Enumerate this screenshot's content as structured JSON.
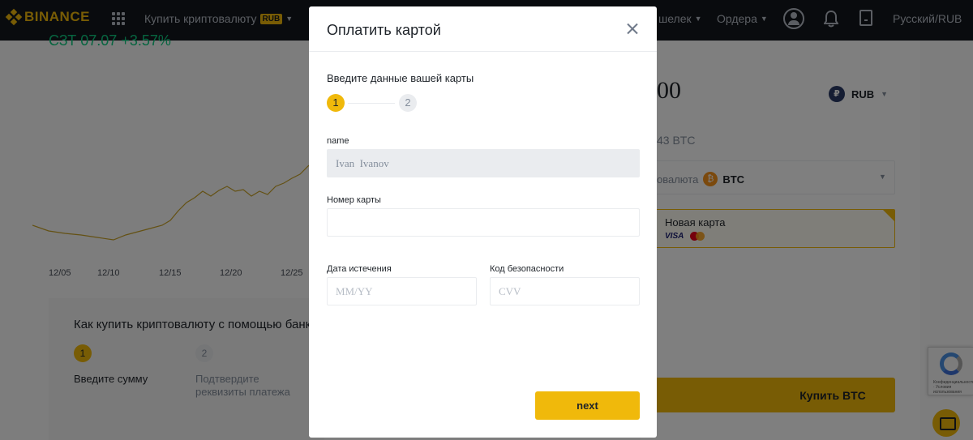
{
  "header": {
    "logo_text": "BINANCE",
    "nav_buy_label": "Купить криптовалюту",
    "nav_buy_badge": "RUB",
    "nav_wallet_label": "шелек",
    "nav_orders_label": "Ордера",
    "nav_lang_label": "Русский/RUB"
  },
  "background": {
    "price_partial": "СЗТ 07.07  +3.57%",
    "chart_dates": [
      "12/05",
      "12/10",
      "12/15",
      "12/20",
      "12/25"
    ],
    "how_to": {
      "title": "Как купить криптовалюту с помощью банк",
      "step1_number": "1",
      "step1_label": "Введите сумму",
      "step2_number": "2",
      "step2_label": "Подтвердите реквизиты платежа"
    },
    "buy_panel": {
      "amount_partial": "00",
      "fiat_symbol": "₽",
      "fiat_code": "RUB",
      "btc_estimate_partial": "43 BTC",
      "currency_label_partial": "овалюта",
      "crypto_code": "BTC",
      "crypto_symbol": "₿",
      "card_label": "Новая карта",
      "card_brand_visa": "VISA",
      "buy_button_label": "Купить BTC"
    },
    "recaptcha_text": "Конфиденциальность · Условия использования"
  },
  "modal": {
    "title": "Оплатить картой",
    "subtitle": "Введите данные вашей карты",
    "steps": [
      "1",
      "2"
    ],
    "current_step": 1,
    "name_label": "name",
    "name_value": "Ivan  Ivanov",
    "card_number_label": "Номер карты",
    "card_number_value": "",
    "expiry_label": "Дата истечения",
    "expiry_placeholder": "MM/YY",
    "cvv_label": "Код безопасности",
    "cvv_placeholder": "CVV",
    "next_label": "next"
  },
  "colors": {
    "brand": "#f0b90b",
    "topbar": "#12161c",
    "chart_line": "#c9a227",
    "overlay": "rgba(0,0,0,0.5)"
  },
  "icons": {
    "close": "close-icon",
    "apps": "apps-grid-icon",
    "user": "user-icon",
    "notifications": "bell-icon",
    "download": "download-icon",
    "chat": "chat-icon"
  }
}
